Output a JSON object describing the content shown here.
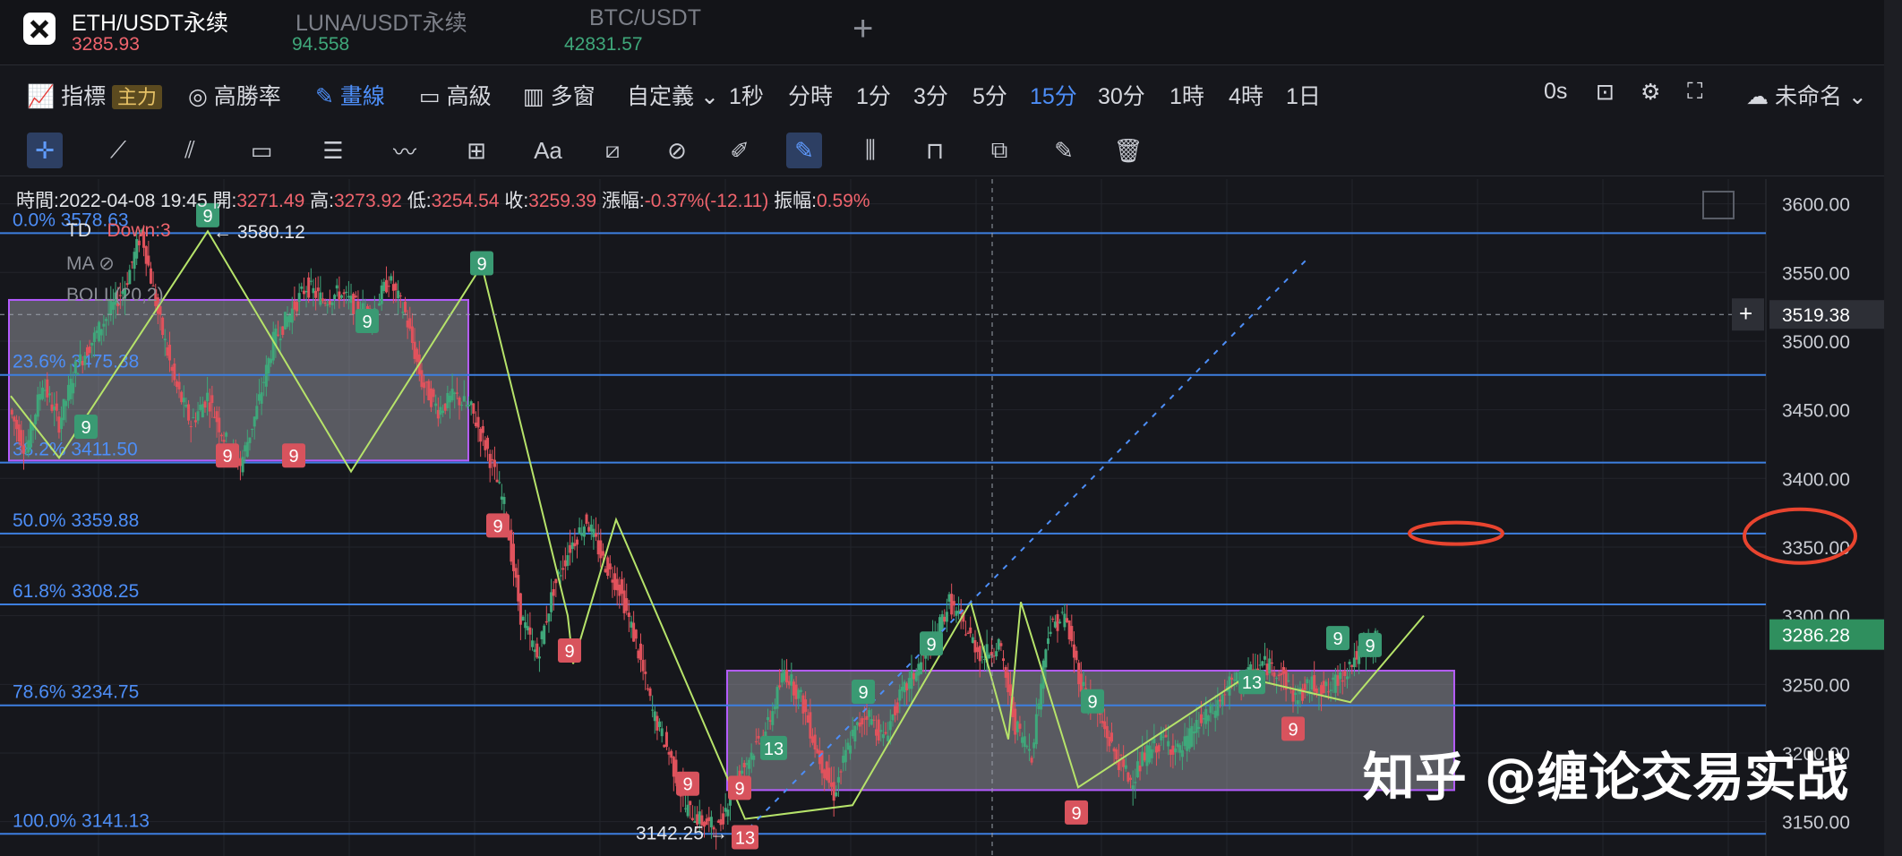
{
  "tabs": [
    {
      "name": "ETH/USDT永续",
      "price": "3285.93",
      "price_color": "#f0646d"
    },
    {
      "name": "LUNA/USDT永续",
      "price": "94.558",
      "price_color": "#3fa77a"
    },
    {
      "name": "BTC/USDT",
      "price": "42831.57",
      "price_color": "#3fa77a"
    }
  ],
  "toolbar": {
    "indicator": "指標",
    "main_tag": "主力",
    "high_win": "高勝率",
    "draw": "畫線",
    "advanced": "高級",
    "multi": "多窗",
    "custom": "自定義",
    "intervals": [
      "1秒",
      "分時",
      "1分",
      "3分",
      "5分",
      "15分",
      "30分",
      "1時",
      "4時",
      "1日"
    ],
    "active_interval": "15分",
    "countdown": "0s",
    "layout_name": "未命名"
  },
  "info": {
    "time_label": "時間:",
    "time": "2022-04-08 19:45",
    "open_label": "開:",
    "open": "3271.49",
    "high_label": "高:",
    "high": "3273.92",
    "low_label": "低:",
    "low": "3254.54",
    "close_label": "收:",
    "close": "3259.39",
    "change_label": "漲幅:",
    "change": "-0.37%(-12.11)",
    "amp_label": "振幅:",
    "amp": "0.59%"
  },
  "legend": {
    "td": "TD",
    "td_value": "Down:3",
    "ma": "MA",
    "boll": "BOLL(20,2)"
  },
  "watermark": "知乎 @缠论交易实战",
  "chart_data": {
    "type": "candlestick",
    "symbol": "ETH/USDT永续",
    "interval": "15分",
    "ylim": [
      3125,
      3618
    ],
    "y_ticks": [
      3600,
      3550,
      3500,
      3450,
      3400,
      3350,
      3300,
      3250,
      3200,
      3150
    ],
    "crosshair_price": "3519.38",
    "last_price": "3286.28",
    "fib_levels": [
      {
        "label": "0.0%",
        "price": 3578.63,
        "text": "3578.63"
      },
      {
        "label": "23.6%",
        "price": 3475.38,
        "text": "3475.38"
      },
      {
        "label": "38.2%",
        "price": 3411.5,
        "text": "3411.50"
      },
      {
        "label": "50.0%",
        "price": 3359.88,
        "text": "3359.88"
      },
      {
        "label": "61.8%",
        "price": 3308.25,
        "text": "3308.25"
      },
      {
        "label": "78.6%",
        "price": 3234.75,
        "text": "3234.75"
      },
      {
        "label": "100.0%",
        "price": 3141.13,
        "text": "3141.13"
      }
    ],
    "annotations": [
      {
        "text": "← 3580.12",
        "price": 3580.12
      },
      {
        "text": "3142.25 →",
        "price": 3142.25
      }
    ],
    "close_path": [
      3450,
      3420,
      3470,
      3440,
      3480,
      3500,
      3520,
      3540,
      3580,
      3520,
      3470,
      3440,
      3460,
      3430,
      3410,
      3450,
      3500,
      3520,
      3540,
      3530,
      3535,
      3525,
      3520,
      3545,
      3520,
      3470,
      3450,
      3460,
      3450,
      3420,
      3380,
      3300,
      3270,
      3320,
      3350,
      3370,
      3340,
      3320,
      3280,
      3230,
      3200,
      3160,
      3150,
      3145,
      3180,
      3200,
      3220,
      3260,
      3240,
      3200,
      3170,
      3210,
      3230,
      3210,
      3240,
      3260,
      3280,
      3310,
      3290,
      3270,
      3280,
      3220,
      3200,
      3290,
      3300,
      3250,
      3230,
      3200,
      3180,
      3200,
      3210,
      3200,
      3220,
      3230,
      3250,
      3255,
      3265,
      3260,
      3240,
      3250,
      3245,
      3260,
      3275,
      3285
    ]
  }
}
